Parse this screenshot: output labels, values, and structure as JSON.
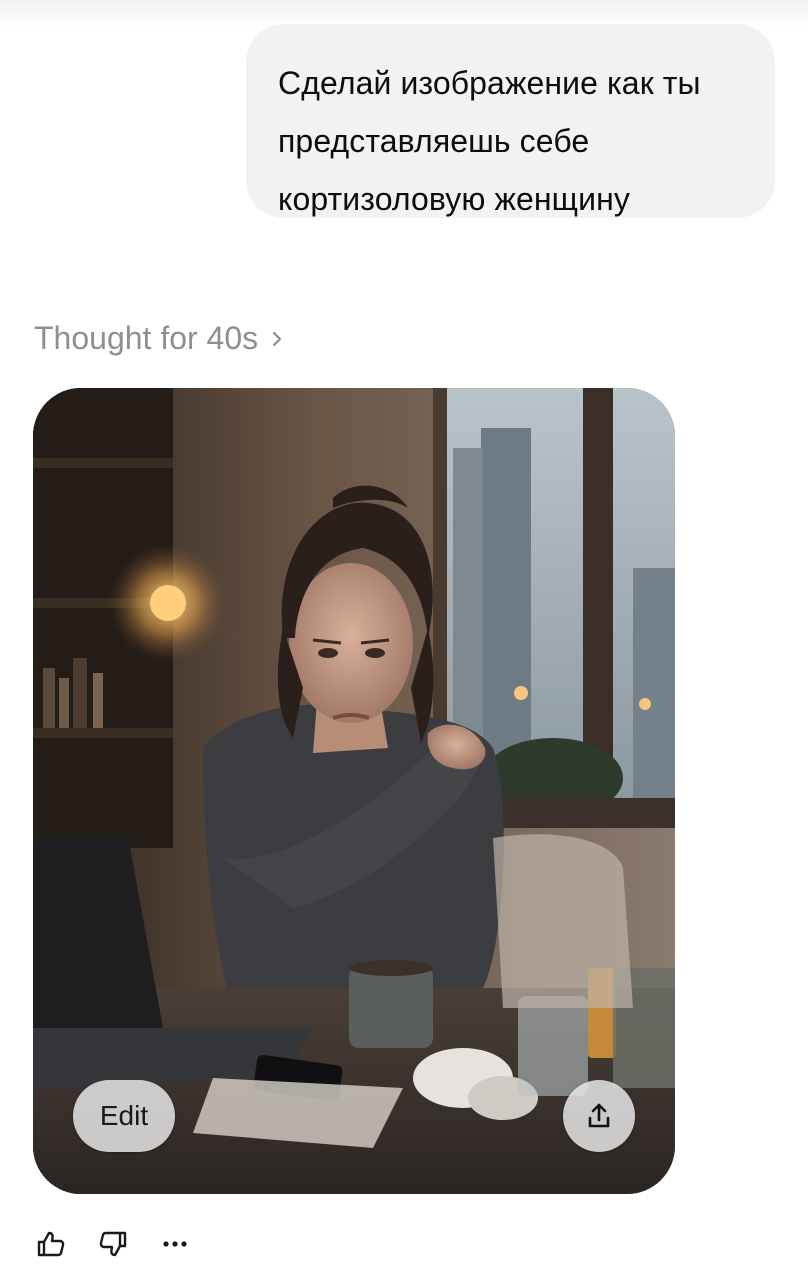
{
  "user_message": {
    "lines": [
      "Сделай изображение как ты",
      "представляешь себе",
      "кортизоловую женщину"
    ]
  },
  "thought": {
    "label": "Thought for 40s",
    "icon": "chevron-right-icon"
  },
  "generated_image": {
    "edit_label": "Edit",
    "share_icon": "share-icon"
  },
  "actions": {
    "icons": [
      "thumbs-up-icon",
      "thumbs-down-icon",
      "more-icon"
    ]
  },
  "colors": {
    "bubble": "#f2f2f2",
    "muted_text": "#8f8f8f",
    "text": "#0d0d0d"
  }
}
